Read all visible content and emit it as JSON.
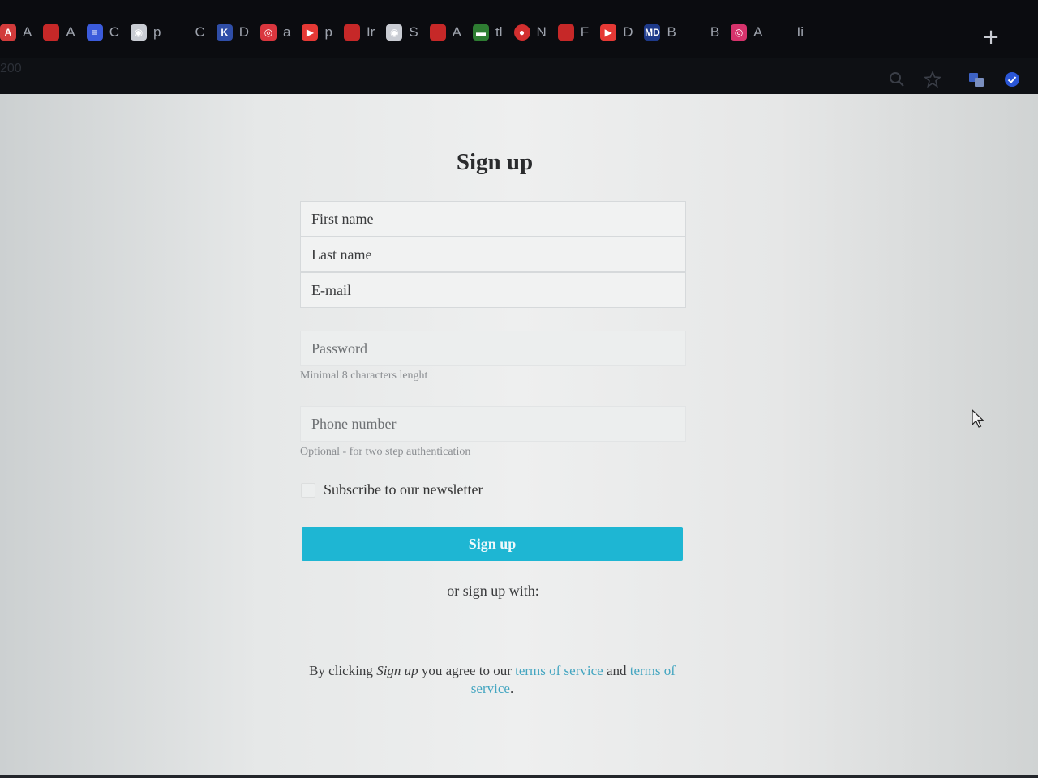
{
  "browser": {
    "tabs": [
      {
        "title": "A",
        "icon": "letter-a-icon",
        "glyph": "A",
        "color": "#d23b3b"
      },
      {
        "title": "A",
        "icon": "link-icon",
        "glyph": "",
        "color": "#c62828"
      },
      {
        "title": "C",
        "icon": "docs-icon",
        "glyph": "≡",
        "color": "#3b5bdb"
      },
      {
        "title": "p",
        "icon": "github-icon",
        "glyph": "◉",
        "color": "#c9ccd3"
      },
      {
        "title": "C",
        "icon": "blank-icon",
        "glyph": "",
        "color": "transparent"
      },
      {
        "title": "D",
        "icon": "k-logo-icon",
        "glyph": "K",
        "color": "#2f4ea8"
      },
      {
        "title": "a",
        "icon": "target-icon",
        "glyph": "◎",
        "color": "#d9363e"
      },
      {
        "title": "p",
        "icon": "youtube-icon",
        "glyph": "▶",
        "color": "#e53935"
      },
      {
        "title": "Ir",
        "icon": "link-icon",
        "glyph": "",
        "color": "#c62828"
      },
      {
        "title": "S",
        "icon": "github-icon",
        "glyph": "◉",
        "color": "#c9ccd3"
      },
      {
        "title": "A",
        "icon": "link-icon",
        "glyph": "",
        "color": "#c62828"
      },
      {
        "title": "tl",
        "icon": "green-bar-icon",
        "glyph": "▬",
        "color": "#2e7d32"
      },
      {
        "title": "N",
        "icon": "red-circle-icon",
        "glyph": "●",
        "color": "#d32f2f"
      },
      {
        "title": "F",
        "icon": "link-icon",
        "glyph": "",
        "color": "#c62828"
      },
      {
        "title": "D",
        "icon": "youtube-icon",
        "glyph": "▶",
        "color": "#e53935"
      },
      {
        "title": "B",
        "icon": "md-icon",
        "glyph": "MD",
        "color": "#1e3a8a"
      },
      {
        "title": "B",
        "icon": "text-icon",
        "glyph": "",
        "color": "transparent"
      },
      {
        "title": "A",
        "icon": "instagram-icon",
        "glyph": "◎",
        "color": "#d6336c"
      },
      {
        "title": "Ii",
        "icon": "blank-icon",
        "glyph": "",
        "color": "transparent"
      }
    ],
    "address_text": "200"
  },
  "form": {
    "title": "Sign up",
    "first_name_placeholder": "First name",
    "last_name_placeholder": "Last name",
    "email_placeholder": "E-mail",
    "password_placeholder": "Password",
    "password_hint": "Minimal 8 characters lenght",
    "phone_placeholder": "Phone number",
    "phone_hint": "Optional - for two step authentication",
    "newsletter_label": "Subscribe to our newsletter",
    "newsletter_checked": false,
    "submit_label": "Sign up",
    "alt_signup_text": "or sign up with:",
    "terms": {
      "prefix": "By clicking ",
      "emphasis": "Sign up",
      "middle": " you agree to our ",
      "link1": "terms of service",
      "and": " and ",
      "link2": "terms of service",
      "suffix": "."
    }
  },
  "colors": {
    "accent": "#1eb6d3",
    "link": "#43a5c0"
  }
}
